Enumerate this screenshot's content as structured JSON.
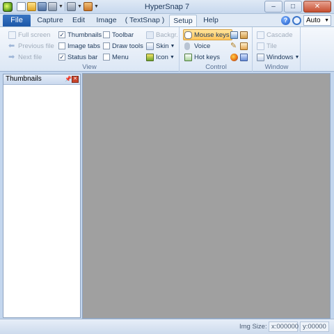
{
  "window": {
    "title": "HyperSnap 7",
    "controls": {
      "minimize": "–",
      "maximize": "□",
      "close": "✕"
    }
  },
  "quick_access": [
    "new-icon",
    "open-icon",
    "save-icon",
    "tool-icon",
    "capture-icon"
  ],
  "tabs": [
    {
      "label": "File",
      "active": false
    },
    {
      "label": "Capture",
      "active": false
    },
    {
      "label": "Edit",
      "active": false
    },
    {
      "label": "Image",
      "active": false
    },
    {
      "label": "( TextSnap )",
      "active": false
    },
    {
      "label": "Setup",
      "active": true
    },
    {
      "label": "Help",
      "active": false
    }
  ],
  "help_area": {
    "zoom_value": "Auto"
  },
  "ribbon": {
    "view": {
      "label": "View",
      "nav": [
        {
          "label": "Full screen",
          "icon": "fullscreen-icon",
          "enabled": false
        },
        {
          "label": "Previous file",
          "icon": "prev-file-icon",
          "enabled": false
        },
        {
          "label": "Next file",
          "icon": "next-file-icon",
          "enabled": false
        }
      ],
      "toggles_col1": [
        {
          "label": "Thumbnails",
          "checked": true
        },
        {
          "label": "Image tabs",
          "checked": false
        },
        {
          "label": "Status bar",
          "checked": true
        }
      ],
      "toggles_col2": [
        {
          "label": "Toolbar",
          "checked": false
        },
        {
          "label": "Draw tools",
          "checked": false
        },
        {
          "label": "Menu",
          "checked": false
        }
      ],
      "backgr": "Backgr.",
      "skin": "Skin",
      "icon": "Icon"
    },
    "control": {
      "label": "Control",
      "items": [
        {
          "label": "Mouse keys",
          "icon": "mouse-icon",
          "highlighted": true
        },
        {
          "label": "Voice",
          "icon": "microphone-icon",
          "highlighted": false
        },
        {
          "label": "Hot keys",
          "icon": "hotkeys-icon",
          "highlighted": false
        }
      ]
    },
    "window": {
      "label": "Window",
      "items": [
        {
          "label": "Cascade",
          "enabled": false
        },
        {
          "label": "Tile",
          "enabled": false
        },
        {
          "label": "Windows",
          "enabled": true
        }
      ]
    }
  },
  "thumbnails_panel": {
    "title": "Thumbnails"
  },
  "statusbar": {
    "img_size_label": "Img Size:",
    "x": "x:000000",
    "y": "y:00000"
  }
}
